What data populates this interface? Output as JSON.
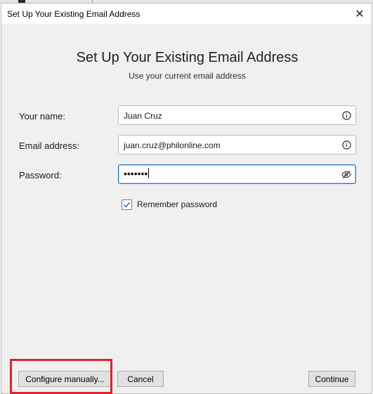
{
  "window": {
    "title": "Set Up Your Existing Email Address",
    "close_glyph": "✕"
  },
  "header": {
    "title": "Set Up Your Existing Email Address",
    "subtitle": "Use your current email address"
  },
  "form": {
    "name_label": "Your name:",
    "name_value": "Juan Cruz",
    "email_label": "Email address:",
    "email_value": "juan.cruz@philonline.com",
    "password_label": "Password:",
    "password_masked": "•••••••",
    "remember_label": "Remember password",
    "remember_checked": true
  },
  "icons": {
    "name_field_icon": "info-icon",
    "email_field_icon": "info-icon",
    "password_field_icon": "eye-slash-icon"
  },
  "buttons": {
    "configure": "Configure manually...",
    "cancel": "Cancel",
    "continue": "Continue"
  },
  "colors": {
    "highlight": "#d9262c",
    "focus_border": "#2a7abf",
    "dialog_bg": "#f0f0f0"
  }
}
